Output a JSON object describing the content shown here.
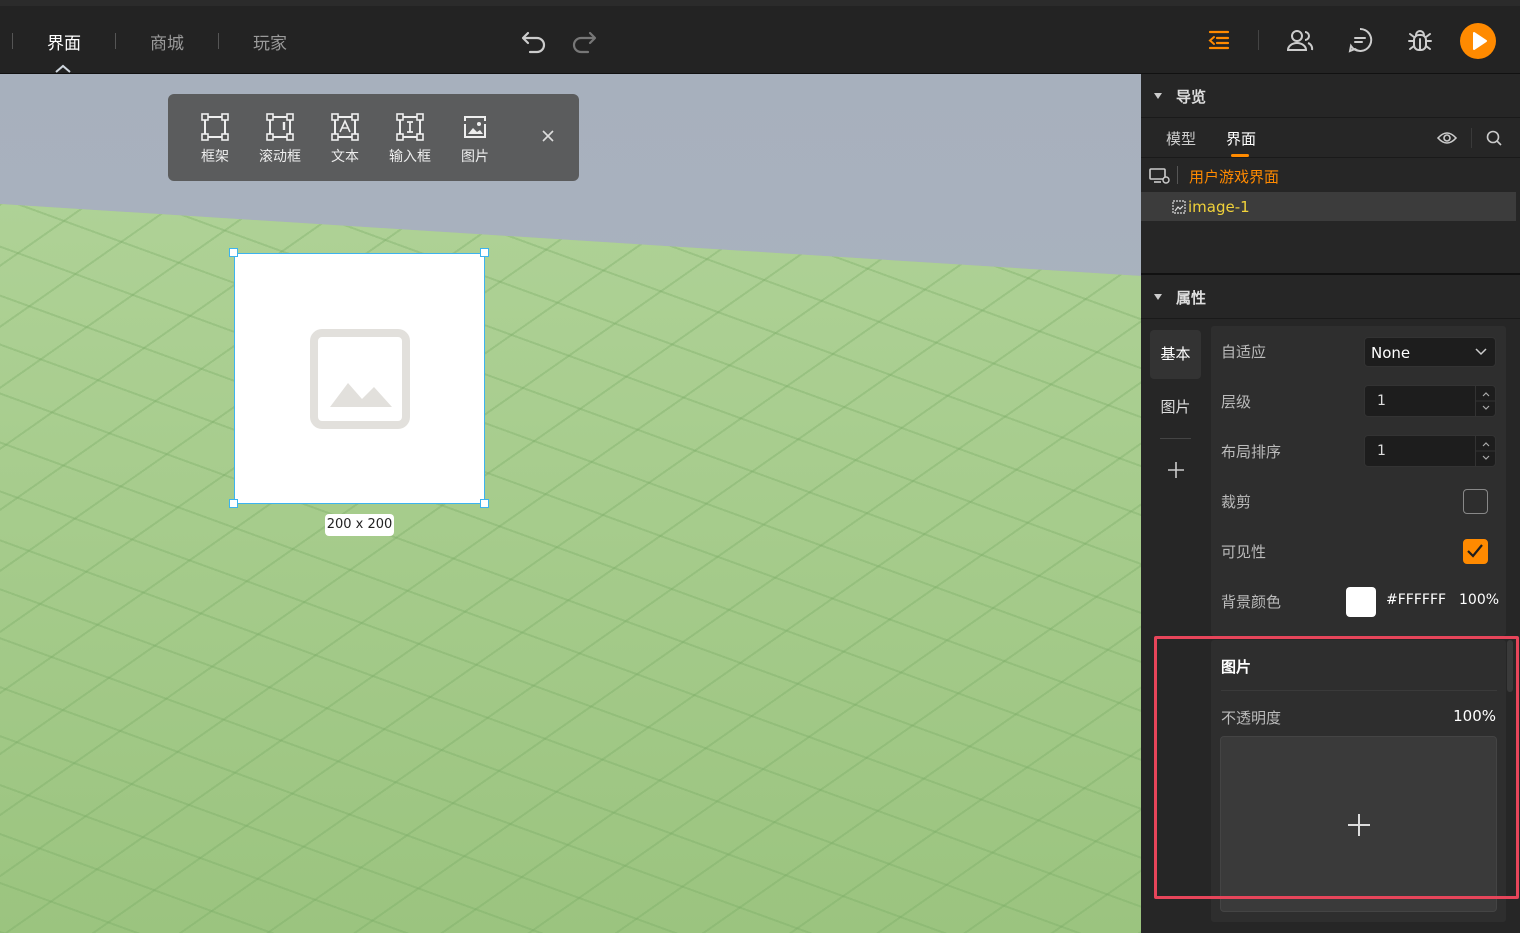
{
  "topbar": {
    "tabs": [
      {
        "label": "界面",
        "active": true
      },
      {
        "label": "商城",
        "active": false
      },
      {
        "label": "玩家",
        "active": false
      }
    ],
    "icons": [
      "undo-icon",
      "redo-icon",
      "outline-list-icon",
      "users-icon",
      "chat-icon",
      "bug-icon",
      "play-icon"
    ],
    "accent": "#FF8A00"
  },
  "toolbar": {
    "tools": [
      {
        "label": "框架",
        "icon": "frame-icon"
      },
      {
        "label": "滚动框",
        "icon": "scroll-frame-icon"
      },
      {
        "label": "文本",
        "icon": "text-icon"
      },
      {
        "label": "输入框",
        "icon": "input-box-icon"
      },
      {
        "label": "图片",
        "icon": "image-icon"
      }
    ],
    "close_icon": "close-icon"
  },
  "canvas": {
    "selected_element_size": "200 x 200",
    "selection_color": "#3DB3EF"
  },
  "navigator": {
    "title": "导览",
    "tabs": [
      {
        "label": "模型",
        "active": false
      },
      {
        "label": "界面",
        "active": true
      }
    ],
    "root": "用户游戏界面",
    "items": [
      "image-1"
    ]
  },
  "properties": {
    "title": "属性",
    "side_tabs": [
      {
        "label": "基本",
        "active": true
      },
      {
        "label": "图片",
        "active": false
      }
    ],
    "fields": {
      "adaptive": {
        "label": "自适应",
        "value": "None"
      },
      "layer": {
        "label": "层级",
        "value": "1"
      },
      "layout_order": {
        "label": "布局排序",
        "value": "1"
      },
      "clip": {
        "label": "裁剪",
        "checked": false
      },
      "visible": {
        "label": "可见性",
        "checked": true
      },
      "bg_color": {
        "label": "背景颜色",
        "hex": "#FFFFFF",
        "opacity": "100%"
      }
    },
    "image_section": {
      "title": "图片",
      "opacity_label": "不透明度",
      "opacity_value": "100%"
    }
  }
}
